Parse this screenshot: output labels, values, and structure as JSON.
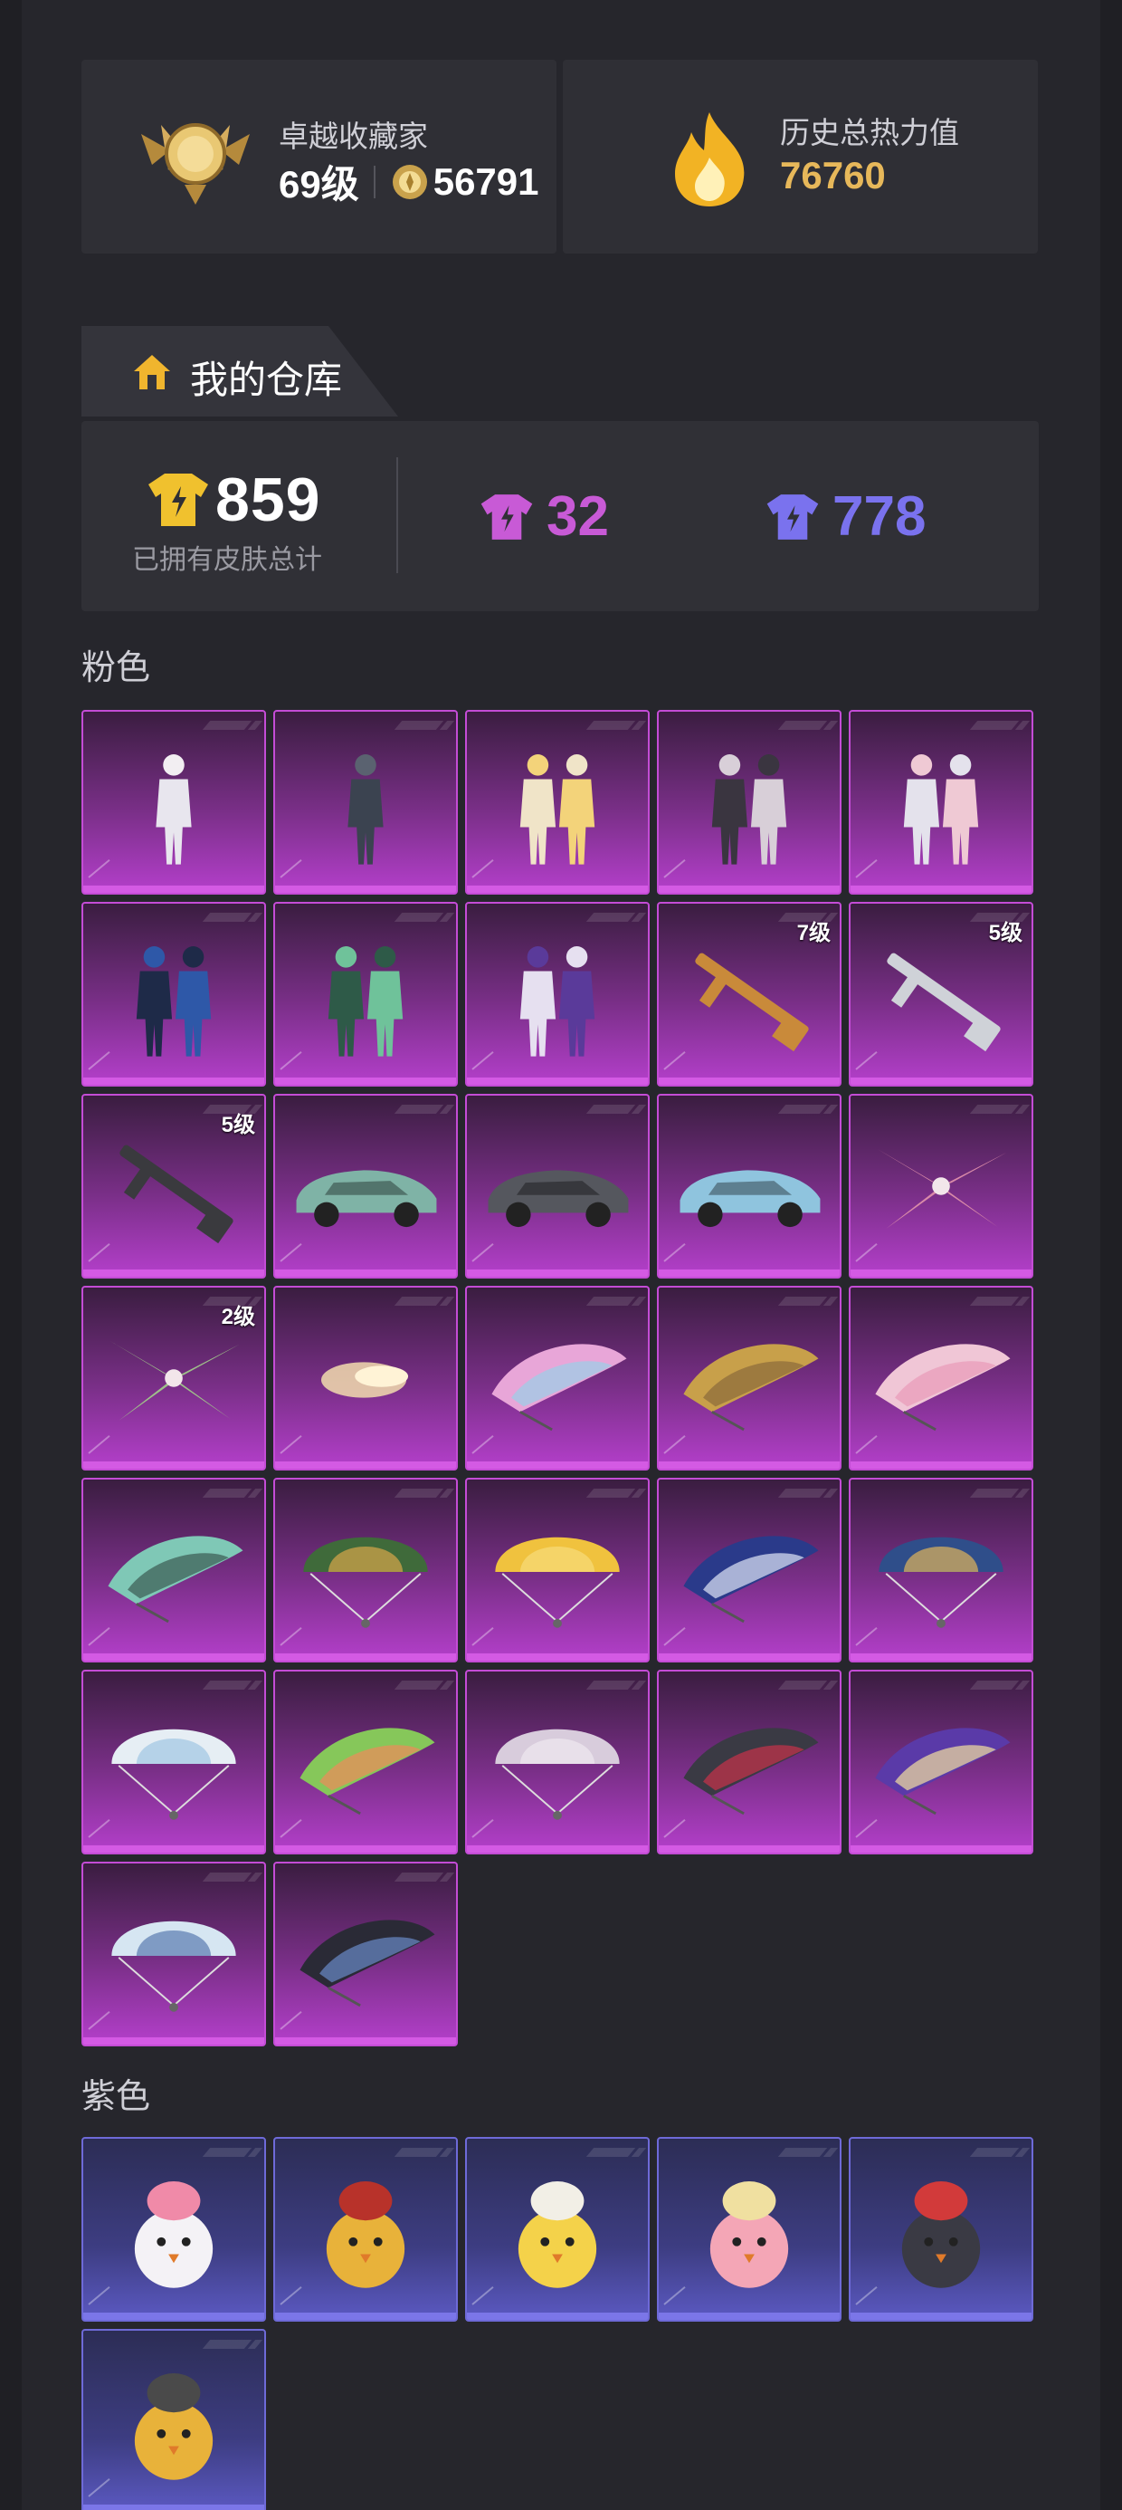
{
  "profile": {
    "rank_title": "卓越收藏家",
    "level": "69级",
    "points": "56791",
    "heat_label": "历史总热力值",
    "heat_value": "76760"
  },
  "warehouse": {
    "title": "我的仓库",
    "total_count": "859",
    "total_label": "已拥有皮肤总计",
    "pink_count": "32",
    "purple_count": "778"
  },
  "sections": [
    {
      "label": "粉色",
      "rarity": "pink",
      "items": [
        {
          "kind": "outfit-single",
          "level": ""
        },
        {
          "kind": "outfit-armor",
          "level": ""
        },
        {
          "kind": "outfit-clowns",
          "level": ""
        },
        {
          "kind": "outfit-pair-dark",
          "level": ""
        },
        {
          "kind": "outfit-pair-white",
          "level": ""
        },
        {
          "kind": "outfit-pair-blue",
          "level": ""
        },
        {
          "kind": "outfit-pair-green",
          "level": ""
        },
        {
          "kind": "outfit-pair-purple",
          "level": ""
        },
        {
          "kind": "rifle-gold",
          "level": "7级"
        },
        {
          "kind": "rifle-silver",
          "level": "5级"
        },
        {
          "kind": "rifle-black",
          "level": "5级"
        },
        {
          "kind": "car-green",
          "level": ""
        },
        {
          "kind": "car-grey",
          "level": ""
        },
        {
          "kind": "car-blue",
          "level": ""
        },
        {
          "kind": "glider-pink",
          "level": ""
        },
        {
          "kind": "glider-green",
          "level": "2级"
        },
        {
          "kind": "trail-smoke",
          "level": ""
        },
        {
          "kind": "parachute-wing-pink",
          "level": ""
        },
        {
          "kind": "parachute-wing-gold",
          "level": ""
        },
        {
          "kind": "parachute-wing-rose",
          "level": ""
        },
        {
          "kind": "parachute-wing-teal",
          "level": ""
        },
        {
          "kind": "parachute-dome-green",
          "level": ""
        },
        {
          "kind": "parachute-dome-chick",
          "level": ""
        },
        {
          "kind": "parachute-wing-navy",
          "level": ""
        },
        {
          "kind": "parachute-dome-blue",
          "level": ""
        },
        {
          "kind": "parachute-dome-white",
          "level": ""
        },
        {
          "kind": "parachute-wing-lime",
          "level": ""
        },
        {
          "kind": "parachute-dome-lilac",
          "level": ""
        },
        {
          "kind": "parachute-wing-red",
          "level": ""
        },
        {
          "kind": "parachute-wing-check",
          "level": ""
        },
        {
          "kind": "parachute-dome-sky",
          "level": ""
        },
        {
          "kind": "parachute-wing-dark",
          "level": ""
        }
      ]
    },
    {
      "label": "紫色",
      "rarity": "purple",
      "items": [
        {
          "kind": "pet-bunny",
          "level": ""
        },
        {
          "kind": "pet-chick-shades",
          "level": ""
        },
        {
          "kind": "pet-chick-yellow",
          "level": ""
        },
        {
          "kind": "pet-pink-bird",
          "level": ""
        },
        {
          "kind": "pet-robot",
          "level": ""
        },
        {
          "kind": "pet-chick-helmet",
          "level": ""
        }
      ]
    }
  ],
  "colors": {
    "accent_gold": "#e7b85a",
    "pink": "#c85ad6",
    "purple": "#7a72ee"
  }
}
